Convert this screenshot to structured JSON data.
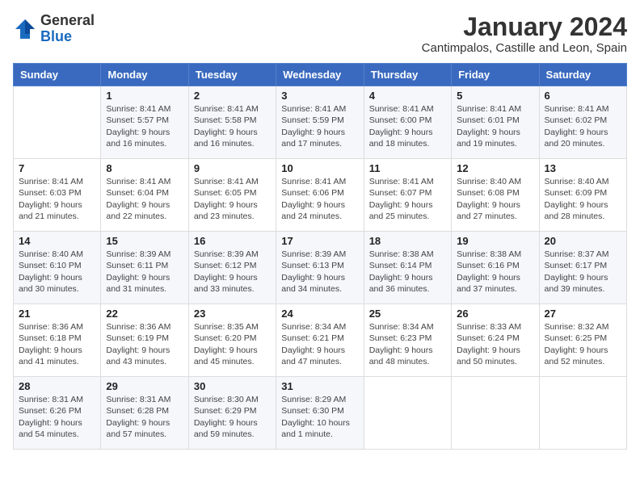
{
  "logo": {
    "general": "General",
    "blue": "Blue"
  },
  "title": "January 2024",
  "location": "Cantimpalos, Castille and Leon, Spain",
  "days_header": [
    "Sunday",
    "Monday",
    "Tuesday",
    "Wednesday",
    "Thursday",
    "Friday",
    "Saturday"
  ],
  "weeks": [
    [
      {
        "day": "",
        "info": ""
      },
      {
        "day": "1",
        "info": "Sunrise: 8:41 AM\nSunset: 5:57 PM\nDaylight: 9 hours and 16 minutes."
      },
      {
        "day": "2",
        "info": "Sunrise: 8:41 AM\nSunset: 5:58 PM\nDaylight: 9 hours and 16 minutes."
      },
      {
        "day": "3",
        "info": "Sunrise: 8:41 AM\nSunset: 5:59 PM\nDaylight: 9 hours and 17 minutes."
      },
      {
        "day": "4",
        "info": "Sunrise: 8:41 AM\nSunset: 6:00 PM\nDaylight: 9 hours and 18 minutes."
      },
      {
        "day": "5",
        "info": "Sunrise: 8:41 AM\nSunset: 6:01 PM\nDaylight: 9 hours and 19 minutes."
      },
      {
        "day": "6",
        "info": "Sunrise: 8:41 AM\nSunset: 6:02 PM\nDaylight: 9 hours and 20 minutes."
      }
    ],
    [
      {
        "day": "7",
        "info": "Sunrise: 8:41 AM\nSunset: 6:03 PM\nDaylight: 9 hours and 21 minutes."
      },
      {
        "day": "8",
        "info": "Sunrise: 8:41 AM\nSunset: 6:04 PM\nDaylight: 9 hours and 22 minutes."
      },
      {
        "day": "9",
        "info": "Sunrise: 8:41 AM\nSunset: 6:05 PM\nDaylight: 9 hours and 23 minutes."
      },
      {
        "day": "10",
        "info": "Sunrise: 8:41 AM\nSunset: 6:06 PM\nDaylight: 9 hours and 24 minutes."
      },
      {
        "day": "11",
        "info": "Sunrise: 8:41 AM\nSunset: 6:07 PM\nDaylight: 9 hours and 25 minutes."
      },
      {
        "day": "12",
        "info": "Sunrise: 8:40 AM\nSunset: 6:08 PM\nDaylight: 9 hours and 27 minutes."
      },
      {
        "day": "13",
        "info": "Sunrise: 8:40 AM\nSunset: 6:09 PM\nDaylight: 9 hours and 28 minutes."
      }
    ],
    [
      {
        "day": "14",
        "info": "Sunrise: 8:40 AM\nSunset: 6:10 PM\nDaylight: 9 hours and 30 minutes."
      },
      {
        "day": "15",
        "info": "Sunrise: 8:39 AM\nSunset: 6:11 PM\nDaylight: 9 hours and 31 minutes."
      },
      {
        "day": "16",
        "info": "Sunrise: 8:39 AM\nSunset: 6:12 PM\nDaylight: 9 hours and 33 minutes."
      },
      {
        "day": "17",
        "info": "Sunrise: 8:39 AM\nSunset: 6:13 PM\nDaylight: 9 hours and 34 minutes."
      },
      {
        "day": "18",
        "info": "Sunrise: 8:38 AM\nSunset: 6:14 PM\nDaylight: 9 hours and 36 minutes."
      },
      {
        "day": "19",
        "info": "Sunrise: 8:38 AM\nSunset: 6:16 PM\nDaylight: 9 hours and 37 minutes."
      },
      {
        "day": "20",
        "info": "Sunrise: 8:37 AM\nSunset: 6:17 PM\nDaylight: 9 hours and 39 minutes."
      }
    ],
    [
      {
        "day": "21",
        "info": "Sunrise: 8:36 AM\nSunset: 6:18 PM\nDaylight: 9 hours and 41 minutes."
      },
      {
        "day": "22",
        "info": "Sunrise: 8:36 AM\nSunset: 6:19 PM\nDaylight: 9 hours and 43 minutes."
      },
      {
        "day": "23",
        "info": "Sunrise: 8:35 AM\nSunset: 6:20 PM\nDaylight: 9 hours and 45 minutes."
      },
      {
        "day": "24",
        "info": "Sunrise: 8:34 AM\nSunset: 6:21 PM\nDaylight: 9 hours and 47 minutes."
      },
      {
        "day": "25",
        "info": "Sunrise: 8:34 AM\nSunset: 6:23 PM\nDaylight: 9 hours and 48 minutes."
      },
      {
        "day": "26",
        "info": "Sunrise: 8:33 AM\nSunset: 6:24 PM\nDaylight: 9 hours and 50 minutes."
      },
      {
        "day": "27",
        "info": "Sunrise: 8:32 AM\nSunset: 6:25 PM\nDaylight: 9 hours and 52 minutes."
      }
    ],
    [
      {
        "day": "28",
        "info": "Sunrise: 8:31 AM\nSunset: 6:26 PM\nDaylight: 9 hours and 54 minutes."
      },
      {
        "day": "29",
        "info": "Sunrise: 8:31 AM\nSunset: 6:28 PM\nDaylight: 9 hours and 57 minutes."
      },
      {
        "day": "30",
        "info": "Sunrise: 8:30 AM\nSunset: 6:29 PM\nDaylight: 9 hours and 59 minutes."
      },
      {
        "day": "31",
        "info": "Sunrise: 8:29 AM\nSunset: 6:30 PM\nDaylight: 10 hours and 1 minute."
      },
      {
        "day": "",
        "info": ""
      },
      {
        "day": "",
        "info": ""
      },
      {
        "day": "",
        "info": ""
      }
    ]
  ]
}
